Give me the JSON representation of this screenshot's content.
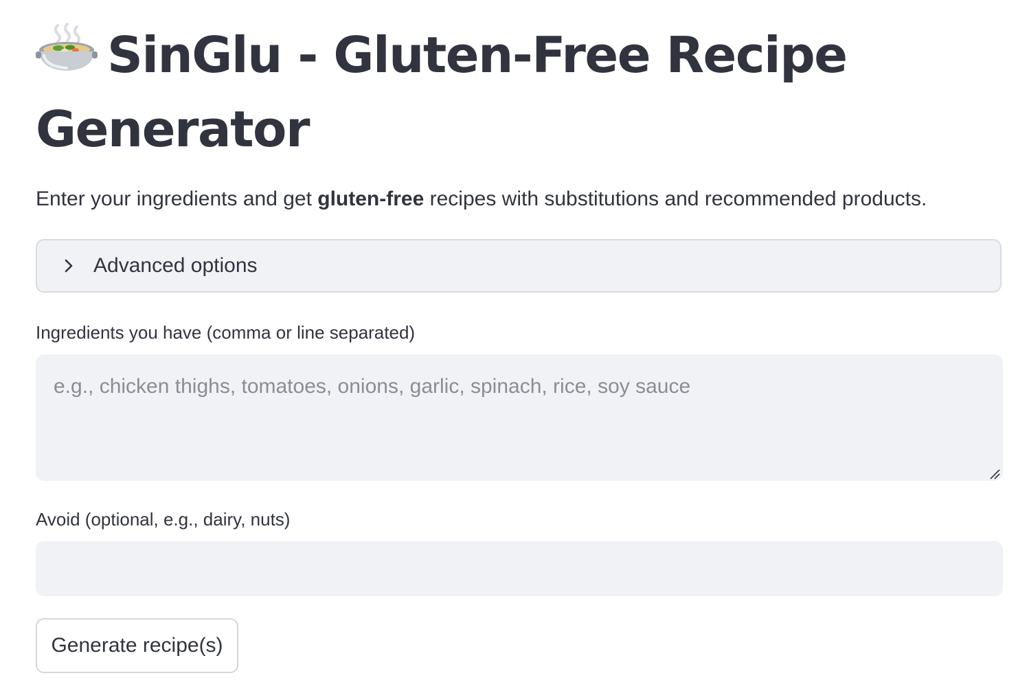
{
  "header": {
    "emoji_icon": "pot-of-food-icon",
    "title": "SinGlu - Gluten-Free Recipe Generator"
  },
  "intro": {
    "before": "Enter your ingredients and get ",
    "bold": "gluten-free",
    "after": " recipes with substitutions and recommended products."
  },
  "advanced": {
    "label": "Advanced options",
    "icon": "chevron-right-icon",
    "expanded": false
  },
  "ingredients": {
    "label": "Ingredients you have (comma or line separated)",
    "placeholder": "e.g., chicken thighs, tomatoes, onions, garlic, spinach, rice, soy sauce",
    "value": ""
  },
  "avoid": {
    "label": "Avoid (optional, e.g., dairy, nuts)",
    "placeholder": "",
    "value": ""
  },
  "generate_button": {
    "label": "Generate recipe(s)"
  },
  "colors": {
    "text": "#31333f",
    "input_bg": "#f0f2f6",
    "placeholder": "#8a8d95",
    "border": "#d4d6dc"
  }
}
